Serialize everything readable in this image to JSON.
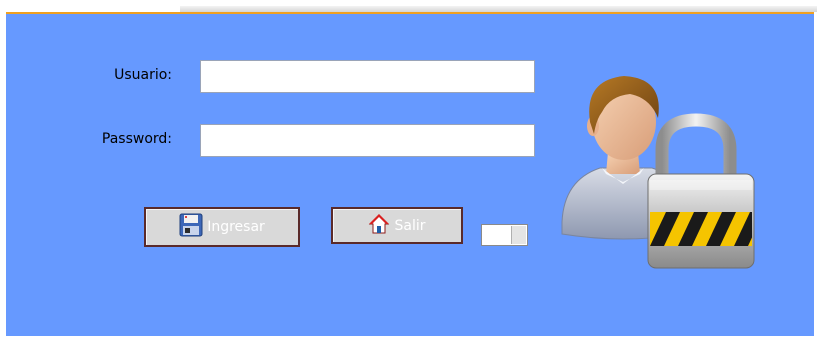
{
  "login": {
    "user_label": "Usuario:",
    "user_value": "",
    "password_label": "Password:",
    "password_value": "",
    "ingresar_label": "Ingresar",
    "salir_label": "Salir"
  },
  "icons": {
    "ingresar": "floppy-disk-icon",
    "salir": "home-icon",
    "illustration": "user-lock-icon"
  },
  "colors": {
    "panel_background": "#6699ff",
    "button_background": "#d9d9d9",
    "button_border": "#5a2a2a",
    "button_text": "#ffffff"
  }
}
